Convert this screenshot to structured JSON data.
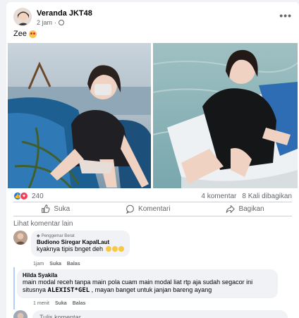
{
  "post": {
    "author": "Veranda JKT48",
    "time": "2 jam",
    "caption": "Zee",
    "more_icon": "more-horizontal-icon",
    "privacy_icon": "globe-icon"
  },
  "reactions": {
    "types": [
      "like",
      "love"
    ],
    "count": "240",
    "comments": "4 komentar",
    "shares": "8 Kali dibagikan"
  },
  "actions": {
    "like_label": "Suka",
    "comment_label": "Komentari",
    "share_label": "Bagikan"
  },
  "see_more": "Lihat komentar lain",
  "comments": [
    {
      "badge": "Penggemar Berat",
      "name": "Budiono Siregar KapalLaut",
      "text": "kyaknya tipis bnget deh",
      "time": "1jam",
      "like": "Suka",
      "reply": "Balas"
    },
    {
      "name": "Hilda Syakila",
      "text_part1": "main modal receh tanpa main pola cuam main modal liat rtp aja sudah segacor ini situsnya",
      "highlight": "ALEXIST*GEL",
      "text_part2": ", mayan banget untuk janjan bareng ayang",
      "time": "1 menit",
      "like": "Suka",
      "reply": "Balas"
    }
  ],
  "composer": {
    "placeholder": "Tulis komentar..."
  },
  "colors": {
    "accent": "#1877f2",
    "love": "#f33e58",
    "muted": "#65676b",
    "bubble": "#f0f2f5"
  }
}
